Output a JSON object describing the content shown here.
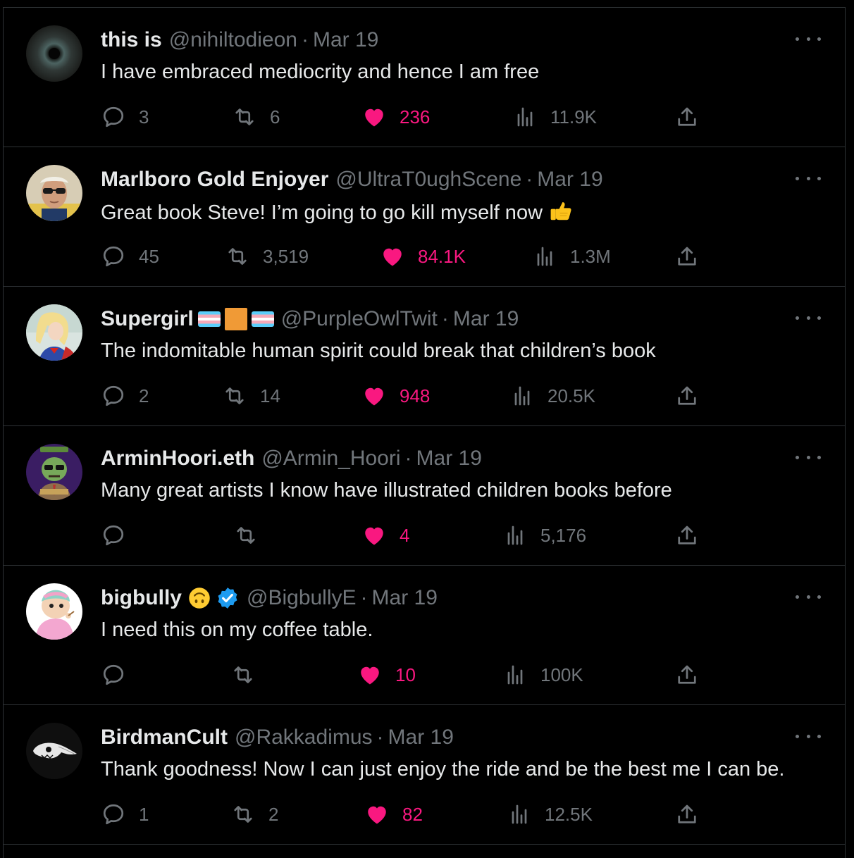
{
  "tweets": [
    {
      "name": "this is",
      "handle": "@nihiltodieon",
      "date": "Mar 19",
      "text": "I have embraced mediocrity and hence I am free",
      "replies": "3",
      "retweets": "6",
      "likes": "236",
      "views": "11.9K",
      "avatar": "eye-avatar",
      "emoji": []
    },
    {
      "name": "Marlboro Gold Enjoyer",
      "handle": "@UltraT0ughScene",
      "date": "Mar 19",
      "text": "Great book Steve! I’m going to go kill myself now",
      "replies": "45",
      "retweets": "3,519",
      "likes": "84.1K",
      "views": "1.3M",
      "avatar": "man-sunglasses-avatar",
      "emoji": [
        "thumbs-up"
      ]
    },
    {
      "name": "Supergirl",
      "handle": "@PurpleOwlTwit",
      "date": "Mar 19",
      "text": "The indomitable human spirit could break that children’s book",
      "replies": "2",
      "retweets": "14",
      "likes": "948",
      "views": "20.5K",
      "avatar": "supergirl-avatar",
      "emoji": [
        "trans-flag",
        "orange-square",
        "trans-flag"
      ]
    },
    {
      "name": "ArminHoori.eth",
      "handle": "@Armin_Hoori",
      "date": "Mar 19",
      "text": "Many great artists I know have illustrated children books before",
      "replies": "",
      "retweets": "",
      "likes": "4",
      "views": "5,176",
      "avatar": "zombie-nft-avatar",
      "emoji": []
    },
    {
      "name": "bigbully",
      "handle": "@BigbullyE",
      "date": "Mar 19",
      "text": "I need this on my coffee table.",
      "replies": "",
      "retweets": "",
      "likes": "10",
      "views": "100K",
      "avatar": "cartoon-avatar",
      "emoji": [
        "upside-down-face",
        "verified-badge"
      ]
    },
    {
      "name": "BirdmanCult",
      "handle": "@Rakkadimus",
      "date": "Mar 19",
      "text": "Thank goodness! Now I can just enjoy the ride and be the best me I can be.",
      "replies": "1",
      "retweets": "2",
      "likes": "82",
      "views": "12.5K",
      "avatar": "bird-skull-avatar",
      "emoji": []
    }
  ],
  "colors": {
    "background": "#000000",
    "text": "#e7e9ea",
    "muted": "#71767b",
    "like": "#f91880",
    "border": "#2f3336",
    "verified": "#1d9bf0"
  }
}
